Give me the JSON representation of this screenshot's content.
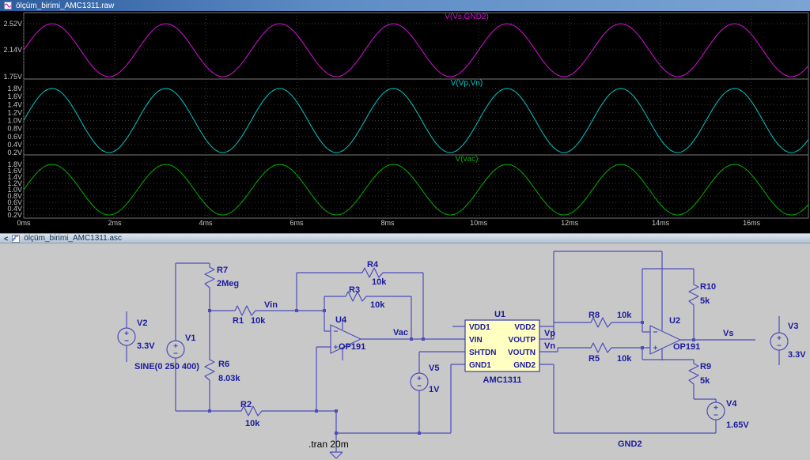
{
  "plot_window": {
    "title": "ölçüm_birimi_AMC1311.raw"
  },
  "schematic_window": {
    "title": "ölçüm_birimi_AMC1311.asc",
    "chevron": "<"
  },
  "chart_data": {
    "type": "line",
    "title": "Transient simulation waveforms",
    "x": {
      "label": "time",
      "unit": "ms",
      "min": 0,
      "max": 17.25,
      "ticks": [
        {
          "v": 0,
          "label": "0ms"
        },
        {
          "v": 2,
          "label": "2ms"
        },
        {
          "v": 4,
          "label": "4ms"
        },
        {
          "v": 6,
          "label": "6ms"
        },
        {
          "v": 8,
          "label": "8ms"
        },
        {
          "v": 10,
          "label": "10ms"
        },
        {
          "v": 12,
          "label": "12ms"
        },
        {
          "v": 14,
          "label": "14ms"
        },
        {
          "v": 16,
          "label": "16ms"
        }
      ]
    },
    "signal": {
      "shape": "sine",
      "frequency_hz": 400,
      "period_ms": 2.5
    },
    "panels": [
      {
        "trace": "V(Vs,GND2)",
        "color": "#d80fd8",
        "center": 2.135,
        "amplitude": 0.385,
        "scale": {
          "vtop": 2.52,
          "vbot": 1.75
        },
        "ticks": [
          {
            "v": 2.52,
            "label": "2.52V"
          },
          {
            "v": 2.14,
            "label": "2.14V"
          },
          {
            "v": 1.75,
            "label": "1.75V"
          }
        ]
      },
      {
        "trace": "V(Vp,Vn)",
        "color": "#00c8c8",
        "center": 1.0,
        "amplitude": 0.8,
        "scale": {
          "vtop": 1.8,
          "vbot": 0.2
        },
        "ticks": [
          {
            "v": 1.8,
            "label": "1.8V"
          },
          {
            "v": 1.6,
            "label": "1.6V"
          },
          {
            "v": 1.4,
            "label": "1.4V"
          },
          {
            "v": 1.2,
            "label": "1.2V"
          },
          {
            "v": 1.0,
            "label": "1.0V"
          },
          {
            "v": 0.8,
            "label": "0.8V"
          },
          {
            "v": 0.6,
            "label": "0.6V"
          },
          {
            "v": 0.4,
            "label": "0.4V"
          },
          {
            "v": 0.2,
            "label": "0.2V"
          }
        ]
      },
      {
        "trace": "V(vac)",
        "color": "#00b400",
        "center": 1.0,
        "amplitude": 0.8,
        "scale": {
          "vtop": 1.8,
          "vbot": 0.2
        },
        "ticks": [
          {
            "v": 1.8,
            "label": "1.8V"
          },
          {
            "v": 1.6,
            "label": "1.6V"
          },
          {
            "v": 1.4,
            "label": "1.4V"
          },
          {
            "v": 1.2,
            "label": "1.2V"
          },
          {
            "v": 1.0,
            "label": "1.0V"
          },
          {
            "v": 0.8,
            "label": "0.8V"
          },
          {
            "v": 0.6,
            "label": "0.6V"
          },
          {
            "v": 0.4,
            "label": "0.4V"
          },
          {
            "v": 0.2,
            "label": "0.2V"
          }
        ]
      }
    ]
  },
  "schematic": {
    "directive": ".tran 20m",
    "components": {
      "V1": {
        "name": "V1",
        "value": "SINE(0 250 400)"
      },
      "V2": {
        "name": "V2",
        "value": "3.3V"
      },
      "V3": {
        "name": "V3",
        "value": "3.3V"
      },
      "V4": {
        "name": "V4",
        "value": "1.65V"
      },
      "V5": {
        "name": "V5",
        "value": "1V"
      },
      "R1": {
        "name": "R1",
        "value": "10k"
      },
      "R2": {
        "name": "R2",
        "value": "10k"
      },
      "R3": {
        "name": "R3",
        "value": "10k"
      },
      "R4": {
        "name": "R4",
        "value": "10k"
      },
      "R5": {
        "name": "R5",
        "value": "10k"
      },
      "R6": {
        "name": "R6",
        "value": "8.03k"
      },
      "R7": {
        "name": "R7",
        "value": "2Meg"
      },
      "R8": {
        "name": "R8",
        "value": "10k"
      },
      "R9": {
        "name": "R9",
        "value": "5k"
      },
      "R10": {
        "name": "R10",
        "value": "5k"
      },
      "U1": {
        "name": "U1",
        "value": "AMC1311",
        "pins_left": [
          "VDD1",
          "VIN",
          "SHTDN",
          "GND1"
        ],
        "pins_right": [
          "VDD2",
          "VOUTP",
          "VOUTN",
          "GND2"
        ]
      },
      "U2": {
        "name": "U2",
        "value": "OP191"
      },
      "U4": {
        "name": "U4",
        "value": "OP191"
      }
    },
    "net_labels": {
      "vin": "Vin",
      "vac": "Vac",
      "vp": "Vp",
      "vn": "Vn",
      "vs": "Vs",
      "gnd2": "GND2"
    }
  }
}
